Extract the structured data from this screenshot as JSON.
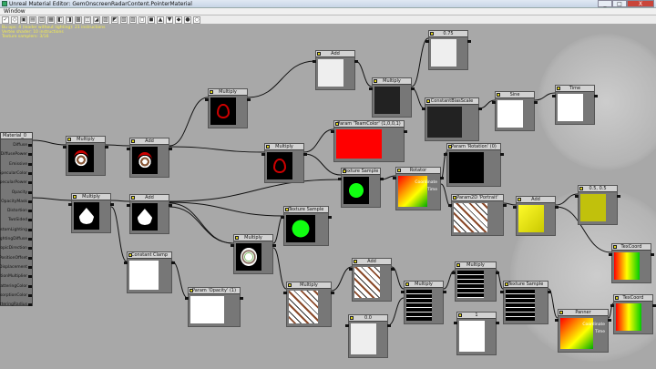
{
  "window": {
    "title": "Unreal Material Editor: GemOnscreenRadarContent.PointerMaterial",
    "minimize": "_",
    "maximize": "□",
    "close": "X"
  },
  "menu": {
    "window": "Window"
  },
  "toolbar": {
    "buttons": [
      "✓",
      "◇",
      "▣",
      "▤",
      "▥",
      "▦",
      "◧",
      "◨",
      "▩",
      "◫",
      "◪",
      "▨",
      "◩",
      "▧",
      "▨",
      "◻",
      "◼",
      "▲",
      "▼",
      "◆",
      "●",
      "○"
    ]
  },
  "stats": "Bu ops: 4 (leader without lighting): 21 instructions\nVertex shader: 10 instructions\nTexture samplers: 3/16",
  "material_node": {
    "title": "Material_0",
    "inputs": [
      "Diffuse",
      "DiffusePower",
      "Emissive",
      "SpecularColor",
      "SpecularPower",
      "Opacity",
      "OpacityMask",
      "Distortion",
      "TwoSided",
      "CustomLighting",
      "CustomLightingDiffuse",
      "AnisotropicDirection",
      "WorldPositionOffset",
      "WorldDisplacement",
      "TessellationMultiplier",
      "SubsurfaceInscatteringColor",
      "SubsurfaceAbsorptionColor",
      "SubsurfaceScatteringRadius"
    ]
  },
  "nodes": [
    {
      "id": "multiply1",
      "title": "Multiply",
      "preview": "emblem"
    },
    {
      "id": "add1",
      "title": "Add",
      "preview": "emblem"
    },
    {
      "id": "multiply2",
      "title": "Multiply",
      "preview": "drop"
    },
    {
      "id": "add2",
      "title": "Add",
      "preview": "drop"
    },
    {
      "id": "constclamp",
      "title": "Constant Clamp",
      "preview": "white"
    },
    {
      "id": "paramOpacity",
      "title": "Param 'Opacity' (1)",
      "preview": "white"
    },
    {
      "id": "multiply3",
      "title": "Multiply",
      "preview": "ring"
    },
    {
      "id": "multiply4",
      "title": "Multiply",
      "preview": "ring"
    },
    {
      "id": "add3",
      "title": "Add",
      "preview": "light"
    },
    {
      "id": "const075",
      "title": "0.75",
      "preview": "light"
    },
    {
      "id": "multiply5",
      "title": "Multiply",
      "preview": "dark"
    },
    {
      "id": "constbiasscale",
      "title": "ConstantBiasScale",
      "preview": "dark"
    },
    {
      "id": "sine",
      "title": "Sine",
      "preview": "white"
    },
    {
      "id": "time1",
      "title": "Time",
      "preview": "white"
    },
    {
      "id": "paramTeamColor",
      "title": "Param 'TeamColor' (1,0,0,1)",
      "preview": "red"
    },
    {
      "id": "texsample1",
      "title": "Texture Sample",
      "preview": "green-dot"
    },
    {
      "id": "rotator1",
      "title": "Rotator",
      "preview": "gradA",
      "extra": [
        "Coordinate",
        "Time"
      ]
    },
    {
      "id": "paramRotation",
      "title": "Param 'Rotation' (0)",
      "preview": "black"
    },
    {
      "id": "texsample2",
      "title": "Texture Sample",
      "preview": "green-dot2"
    },
    {
      "id": "multiply6",
      "title": "Multiply",
      "preview": "swirl"
    },
    {
      "id": "param2dPortrait",
      "title": "Param2D 'Portrait'",
      "preview": "pattern"
    },
    {
      "id": "add4",
      "title": "Add",
      "preview": "yellow"
    },
    {
      "id": "const055",
      "title": "0.5, 0.5",
      "preview": "olive"
    },
    {
      "id": "texcoord1",
      "title": "TexCoord",
      "preview": "gradB"
    },
    {
      "id": "texcoord2",
      "title": "TexCoord",
      "preview": "gradB"
    },
    {
      "id": "multiply7",
      "title": "Multiply",
      "preview": "pattern"
    },
    {
      "id": "add5",
      "title": "Add",
      "preview": "pattern"
    },
    {
      "id": "multiply8",
      "title": "Multiply",
      "preview": "bars"
    },
    {
      "id": "multiply9",
      "title": "Multiply",
      "preview": "bars"
    },
    {
      "id": "texsample3",
      "title": "Texture Sample",
      "preview": "bars"
    },
    {
      "id": "panner",
      "title": "Panner",
      "preview": "gradA",
      "extra": [
        "Coordinate",
        "Time"
      ]
    },
    {
      "id": "const0",
      "title": "0.0",
      "preview": "light"
    },
    {
      "id": "const1",
      "title": "1",
      "preview": "white"
    }
  ]
}
